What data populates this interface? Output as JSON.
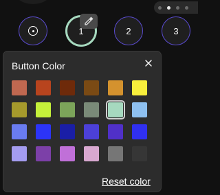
{
  "pager": {
    "dots": 4,
    "active_index": 1
  },
  "buttons": [
    {
      "label": "",
      "icon": "target-icon",
      "selected": false
    },
    {
      "label": "1",
      "icon": "",
      "selected": true
    },
    {
      "label": "2",
      "icon": "",
      "selected": false
    },
    {
      "label": "3",
      "icon": "",
      "selected": false
    }
  ],
  "picker_badge_icon": "eyedropper-icon",
  "popup": {
    "title": "Button Color",
    "close_icon": "close-icon",
    "reset_label": "Reset color",
    "selected_swatch_index": 10,
    "swatches": [
      "#c06850",
      "#b8441e",
      "#6e2a0a",
      "#7a4a14",
      "#d4922e",
      "#f8ef3c",
      "#a69a2c",
      "#c4f03a",
      "#7ca45a",
      "#7a8a78",
      "#a6d9bf",
      "#8ec0f0",
      "#6a7cf0",
      "#2c34f8",
      "#1a1ea6",
      "#4c40d8",
      "#5030c8",
      "#3030f0",
      "#a49cf0",
      "#7c40a8",
      "#c070d8",
      "#d8a8d0",
      "#767676",
      "#363636"
    ]
  }
}
